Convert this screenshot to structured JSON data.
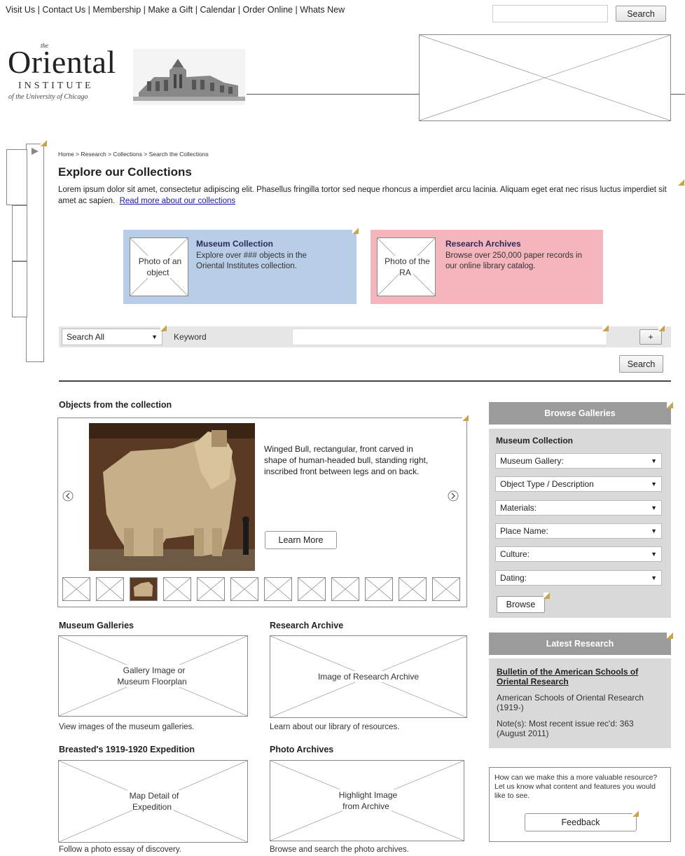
{
  "topnav": {
    "links": [
      "Visit Us",
      "Contact Us",
      "Membership",
      "Make a Gift",
      "Calendar",
      "Order Online",
      "Whats New"
    ],
    "search_button": "Search"
  },
  "logo": {
    "the": "the",
    "name": "Oriental",
    "institute": "INSTITUTE",
    "university": "of the University of Chicago"
  },
  "breadcrumb": "Home > Research > Collections > Search the Collections",
  "page": {
    "title": "Explore our Collections",
    "intro": "Lorem ipsum dolor sit amet, consectetur adipiscing elit. Phasellus fringilla tortor sed neque rhoncus a imperdiet arcu lacinia. Aliquam eget erat nec risus luctus imperdiet sit amet ac sapien.",
    "read_more": "Read more about our collections"
  },
  "cards": {
    "museum": {
      "photo": "Photo of an object",
      "title": "Museum Collection",
      "text": "Explore over ### objects in the Oriental Institutes collection.",
      "color": "#b8cde6"
    },
    "archives": {
      "photo": "Photo of the RA",
      "title": "Research Archives",
      "text": "Browse over 250,000 paper records in our online library catalog.",
      "color": "#f5b5bd"
    }
  },
  "search": {
    "scope": "Search All",
    "keyword_label": "Keyword",
    "add_button": "+",
    "search_button": "Search"
  },
  "objects": {
    "heading": "Objects from the collection",
    "description": "Winged Bull, rectangular, front carved in shape of human-headed bull, standing right, inscribed front between legs and on back.",
    "learn_more": "Learn More",
    "prev": "<",
    "next": ">"
  },
  "sections": {
    "galleries": {
      "heading": "Museum Galleries",
      "image": "Gallery Image or Museum Floorplan",
      "caption": "View images of the museum galleries."
    },
    "research": {
      "heading": "Research Archive",
      "image": "Image of Research Archive",
      "caption": "Learn about our library of resources."
    },
    "expedition": {
      "heading": "Breasted's 1919-1920 Expedition",
      "image": "Map Detail of Expedition",
      "caption": "Follow a photo essay of discovery."
    },
    "photos": {
      "heading": "Photo Archives",
      "image": "Highlight Image from Archive",
      "caption": "Browse and search the photo archives."
    }
  },
  "browse": {
    "heading": "Browse Galleries",
    "subheading": "Museum Collection",
    "selects": [
      "Museum Gallery:",
      "Object Type / Description",
      "Materials:",
      "Place Name:",
      "Culture:",
      "Dating:"
    ],
    "button": "Browse"
  },
  "latest": {
    "heading": "Latest Research",
    "title": "Bulletin of the American Schools of Oriental Research",
    "publisher": "American Schools of Oriental Research (1919-)",
    "note": "Note(s): Most recent issue rec'd: 363 (August 2011)"
  },
  "feedback": {
    "text": "How can we make this a more valuable resource? Let us know what content and features you would like to see.",
    "button": "Feedback"
  }
}
